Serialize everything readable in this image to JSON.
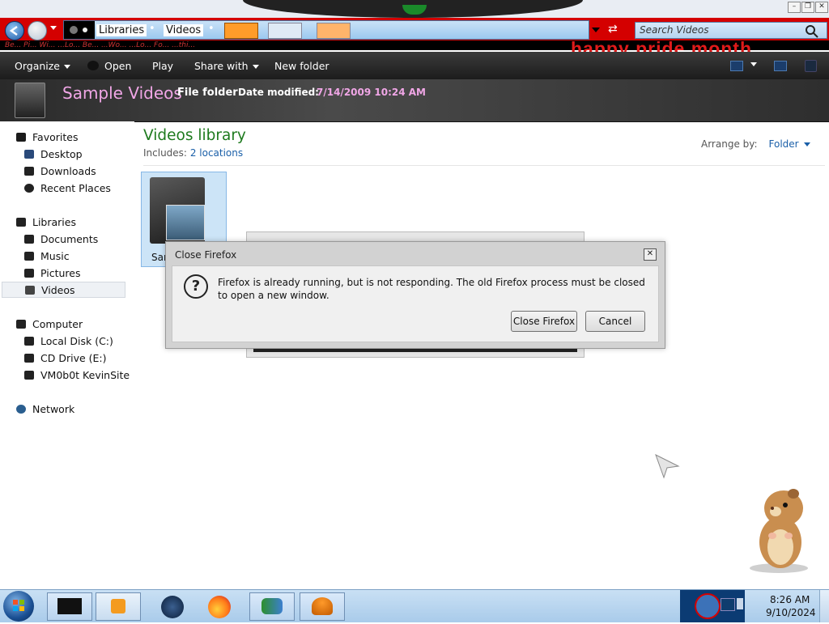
{
  "window": {
    "title_buttons": [
      "minimize",
      "restore",
      "close"
    ],
    "search_placeholder": "Search Videos",
    "banner_text": "happy pride month",
    "banner_scrawl": "Be... Pi... Wi... ...Lo... Be... ...Wo... ...Lo... Fo... ...thi..."
  },
  "breadcrumb": {
    "items": [
      "Libraries",
      "Videos"
    ]
  },
  "commandbar": {
    "organize": "Organize",
    "open": "Open",
    "play": "Play",
    "share_with": "Share with",
    "new_folder": "New folder"
  },
  "details": {
    "name": "Sample Videos",
    "type": "File folder",
    "date_modified_label": "Date modified:",
    "date_modified_value": "7/14/2009 10:24 AM"
  },
  "nav": {
    "favorites": "Favorites",
    "desktop": "Desktop",
    "downloads": "Downloads",
    "recent_places": "Recent Places",
    "libraries": "Libraries",
    "documents": "Documents",
    "music": "Music",
    "pictures": "Pictures",
    "videos": "Videos",
    "computer": "Computer",
    "local_disk": "Local Disk (C:)",
    "cd_drive": "CD Drive (E:)",
    "network_drive": "VM0b0t KevinSite",
    "network": "Network"
  },
  "library": {
    "title": "Videos library",
    "includes_label": "Includes:",
    "includes_link": "2 locations",
    "arrange_label": "Arrange by:",
    "arrange_value": "Folder",
    "folder_label": "Sar"
  },
  "dialog": {
    "title": "Close Firefox",
    "close_glyph": "✕",
    "icon": "question-icon",
    "message": "Firefox is already running, but is not responding. The old Firefox process must be closed to open a new window.",
    "primary_button": "Close Firefox",
    "cancel_button": "Cancel"
  },
  "taskbar": {
    "time": "8:26 AM",
    "date": "9/10/2024"
  },
  "colors": {
    "accent_red": "#d40000",
    "title_pink": "#f0a6e6",
    "library_green": "#1e7a1e",
    "link_blue": "#1a5fa8"
  }
}
